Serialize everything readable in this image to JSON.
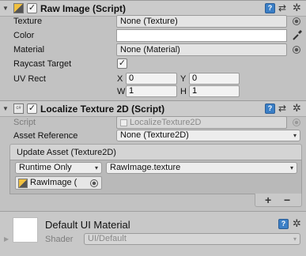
{
  "raw_image": {
    "title": "Raw Image (Script)",
    "fields": {
      "texture": {
        "label": "Texture",
        "value": "None (Texture)"
      },
      "color": {
        "label": "Color"
      },
      "material": {
        "label": "Material",
        "value": "None (Material)"
      },
      "raycast_target": {
        "label": "Raycast Target",
        "checked": true
      },
      "uv_rect": {
        "label": "UV Rect",
        "x_label": "X",
        "x_value": "0",
        "y_label": "Y",
        "y_value": "0",
        "w_label": "W",
        "w_value": "1",
        "h_label": "H",
        "h_value": "1"
      }
    },
    "colors": {
      "color_swatch": "#ffffff"
    }
  },
  "localize": {
    "title": "Localize Texture 2D (Script)",
    "script": {
      "label": "Script",
      "value": "LocalizeTexture2D"
    },
    "asset_reference": {
      "label": "Asset Reference",
      "value": "None (Texture2D)"
    },
    "event": {
      "title": "Update Asset (Texture2D)",
      "runtime": "Runtime Only",
      "method": "RawImage.texture",
      "target": "RawImage (",
      "add_label": "+",
      "remove_label": "−"
    }
  },
  "material_panel": {
    "name": "Default UI Material",
    "shader_label": "Shader",
    "shader_value": "UI/Default"
  },
  "icons": {
    "check": "✓",
    "help": "?",
    "preset": "⇄",
    "gear": "✲",
    "fold_open": "▼",
    "fold_closed": "▶",
    "dropdown": "▾"
  }
}
